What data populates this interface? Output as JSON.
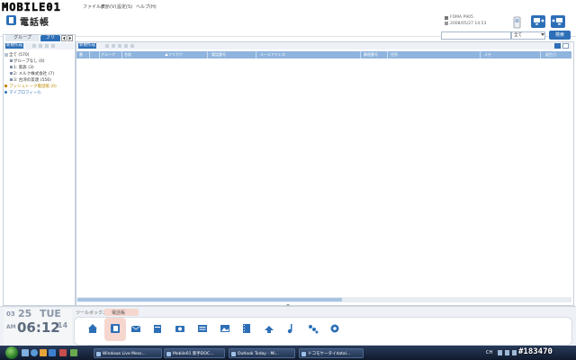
{
  "menubar": {
    "logo": "MOBILE01",
    "items": [
      "ファイル(F)",
      "表示(V)",
      "設定(S)",
      "ヘルプ(H)"
    ]
  },
  "header": {
    "title": "電話帳",
    "device_model": "FOMA P905",
    "device_date": "2008/05/27 14:53"
  },
  "search": {
    "placeholder": "",
    "scope": "全て",
    "button": "検索"
  },
  "left": {
    "tabs": [
      "グループ",
      "フリ"
    ],
    "new_button": "新規作成",
    "tree": [
      {
        "label": "全て (570)",
        "color": "#333333"
      },
      {
        "label": "グループなし (0)",
        "color": "#333333"
      },
      {
        "label": "1: 家族 (3)",
        "color": "#333333"
      },
      {
        "label": "2: メルク株式会社 (7)",
        "color": "#333333"
      },
      {
        "label": "3: 台湾の友達 (556)",
        "color": "#333333"
      },
      {
        "label": "プッシュトーク電話帳 (0)",
        "color": "#c08a00"
      },
      {
        "label": "マイプロフィール",
        "color": "#2d6fb7"
      }
    ]
  },
  "right": {
    "new_button": "新規作成",
    "columns": [
      "番",
      "",
      "グループ",
      "名前",
      "フリガナ",
      "電話番号",
      "メールアドレス",
      "郵便番号",
      "住所",
      "メモ",
      "誕生日"
    ]
  },
  "bottom": {
    "clock": {
      "month": "03",
      "day": "25",
      "weekday": "TUE",
      "ampm": "AM",
      "time": "06:12",
      "sec": "14"
    },
    "toolbar_label": "ツールボックス",
    "tool_tab": "電話帳"
  },
  "taskbar": {
    "items": [
      "Windows Live Mess...",
      "Mobile01 新手DOC...",
      "Outlook Today - Mi...",
      "ドコモケータイdatal..."
    ],
    "tray": "CH",
    "watermark": "#183470"
  },
  "colors": {
    "accent": "#2d6fb7",
    "header_row": "#8fb4dd"
  }
}
